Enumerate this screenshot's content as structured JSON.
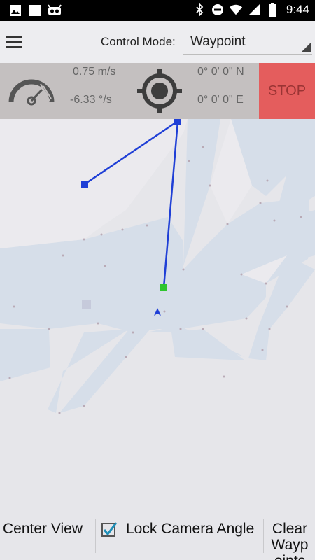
{
  "status_bar": {
    "time": "9:44",
    "left_icons": [
      "image-icon",
      "square-icon",
      "android-debug-icon"
    ],
    "right_icons": [
      "bluetooth-icon",
      "do-not-disturb-icon",
      "wifi-icon",
      "cell-signal-icon",
      "battery-icon"
    ]
  },
  "header": {
    "control_mode_label": "Control Mode:",
    "control_mode_value": "Waypoint"
  },
  "telemetry": {
    "linear_speed": "0.75 m/s",
    "angular_speed": "-6.33 °/s",
    "latitude": "0° 0' 0\" N",
    "longitude": "0° 0' 0\" E",
    "stop_label": "STOP"
  },
  "footer": {
    "center_view_label": "Center View",
    "lock_camera_label": "Lock Camera Angle",
    "lock_camera_checked": true,
    "clear_waypoints_label": "Clear Waypoints"
  },
  "colors": {
    "stop": "#e45d5d",
    "waypoint_line": "#1f3fd6",
    "current_goal": "#2ec52e",
    "accent_check": "#1e8fb8"
  }
}
